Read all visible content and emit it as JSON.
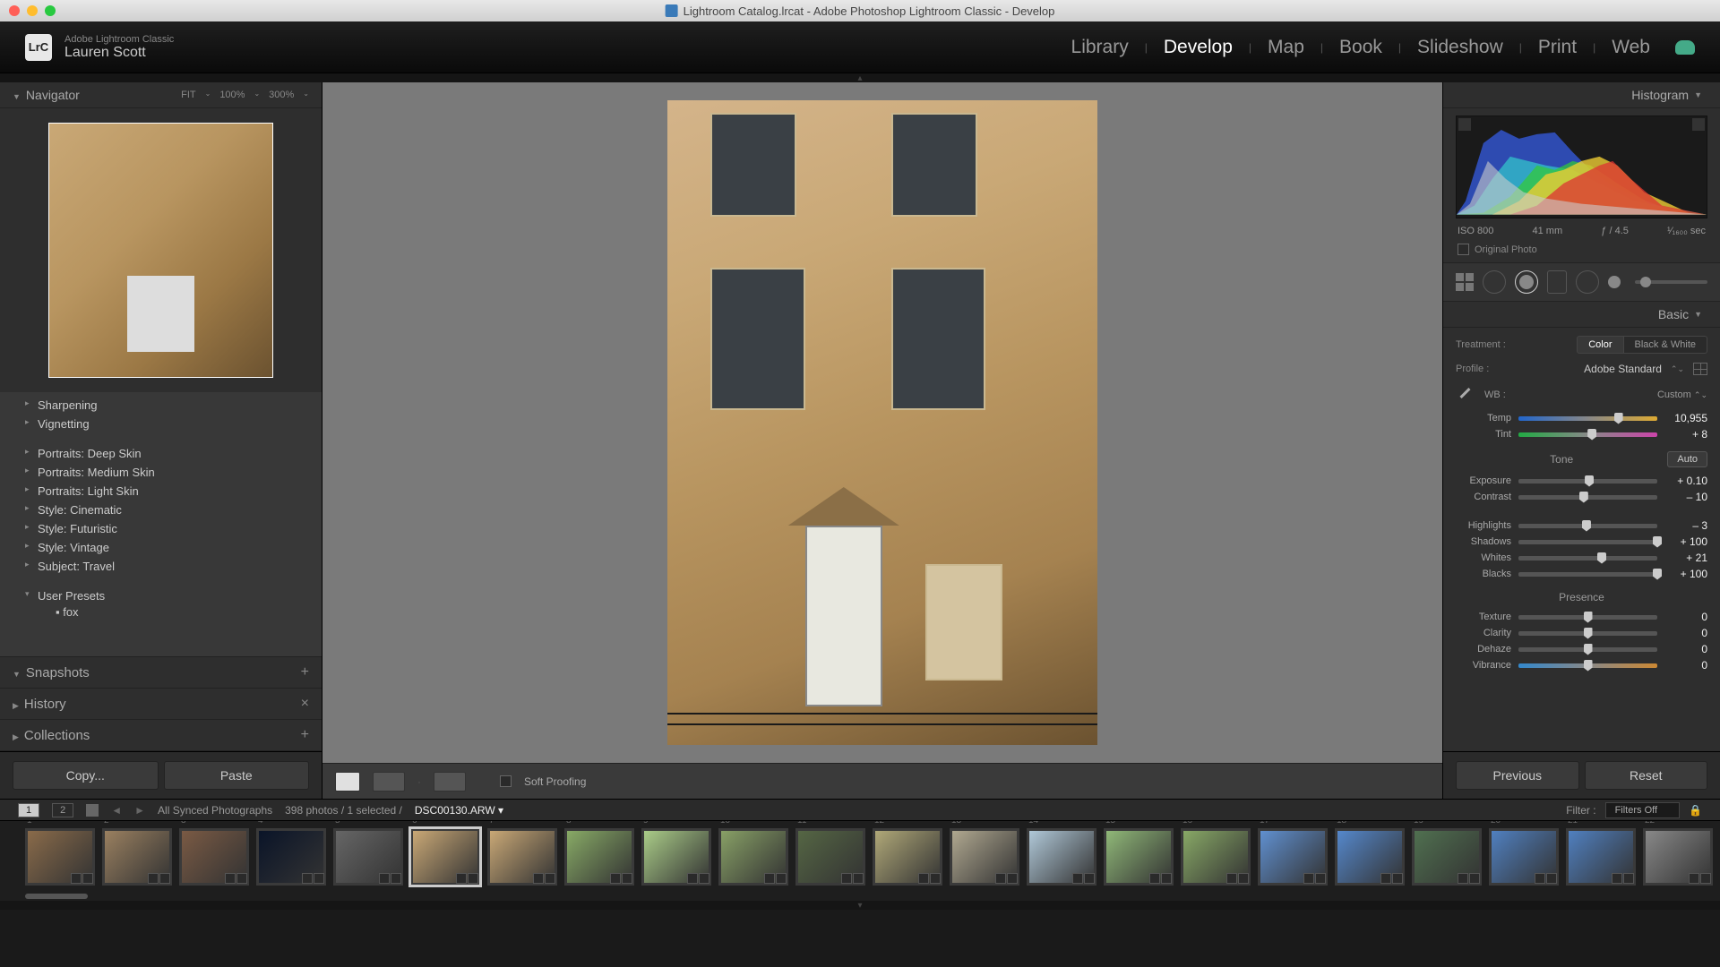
{
  "window": {
    "title": "Lightroom Catalog.lrcat - Adobe Photoshop Lightroom Classic - Develop"
  },
  "header": {
    "app_badge": "LrC",
    "app_line1": "Adobe Lightroom Classic",
    "user_name": "Lauren Scott",
    "modules": [
      "Library",
      "Develop",
      "Map",
      "Book",
      "Slideshow",
      "Print",
      "Web"
    ],
    "active_module": "Develop"
  },
  "left_panel": {
    "navigator": {
      "title": "Navigator",
      "zoom": [
        "FIT",
        "100%",
        "300%"
      ]
    },
    "presets": [
      {
        "label": "Sharpening"
      },
      {
        "label": "Vignetting"
      },
      {
        "gap": true
      },
      {
        "label": "Portraits: Deep Skin"
      },
      {
        "label": "Portraits: Medium Skin"
      },
      {
        "label": "Portraits: Light Skin"
      },
      {
        "label": "Style: Cinematic"
      },
      {
        "label": "Style: Futuristic"
      },
      {
        "label": "Style: Vintage"
      },
      {
        "label": "Subject: Travel"
      },
      {
        "gap": true
      },
      {
        "label": "User Presets",
        "expanded": true,
        "children": [
          "fox"
        ]
      }
    ],
    "sections": {
      "snapshots": "Snapshots",
      "history": "History",
      "collections": "Collections"
    },
    "buttons": {
      "copy": "Copy...",
      "paste": "Paste"
    }
  },
  "canvas_toolbar": {
    "soft_proofing": "Soft Proofing"
  },
  "right_panel": {
    "histogram_title": "Histogram",
    "histogram_info": {
      "iso": "ISO 800",
      "focal": "41 mm",
      "aperture": "ƒ / 4.5",
      "shutter": "¹⁄₁₆₀₀ sec"
    },
    "original_photo": "Original Photo",
    "basic": {
      "title": "Basic",
      "treatment_label": "Treatment :",
      "treatment_color": "Color",
      "treatment_bw": "Black & White",
      "profile_label": "Profile :",
      "profile_value": "Adobe Standard",
      "wb_label": "WB :",
      "wb_value": "Custom",
      "tone_label": "Tone",
      "auto": "Auto",
      "presence_label": "Presence",
      "sliders": {
        "temp": {
          "label": "Temp",
          "value": "10,955",
          "pos": 72,
          "track": "temp"
        },
        "tint": {
          "label": "Tint",
          "value": "+ 8",
          "pos": 53,
          "track": "tint"
        },
        "exposure": {
          "label": "Exposure",
          "value": "+ 0.10",
          "pos": 51,
          "track": "plain"
        },
        "contrast": {
          "label": "Contrast",
          "value": "– 10",
          "pos": 47,
          "track": "plain"
        },
        "highlights": {
          "label": "Highlights",
          "value": "– 3",
          "pos": 49,
          "track": "plain"
        },
        "shadows": {
          "label": "Shadows",
          "value": "+ 100",
          "pos": 100,
          "track": "plain"
        },
        "whites": {
          "label": "Whites",
          "value": "+ 21",
          "pos": 60,
          "track": "plain"
        },
        "blacks": {
          "label": "Blacks",
          "value": "+ 100",
          "pos": 100,
          "track": "plain"
        },
        "texture": {
          "label": "Texture",
          "value": "0",
          "pos": 50,
          "track": "plain"
        },
        "clarity": {
          "label": "Clarity",
          "value": "0",
          "pos": 50,
          "track": "plain"
        },
        "dehaze": {
          "label": "Dehaze",
          "value": "0",
          "pos": 50,
          "track": "plain"
        },
        "vibrance": {
          "label": "Vibrance",
          "value": "0",
          "pos": 50,
          "track": "vib"
        }
      }
    },
    "buttons": {
      "previous": "Previous",
      "reset": "Reset"
    }
  },
  "filmstrip_bar": {
    "source": "All Synced Photographs",
    "count": "398 photos / 1 selected /",
    "filename": "DSC00130.ARW",
    "filter_label": "Filter :",
    "filter_value": "Filters Off"
  },
  "filmstrip": {
    "count": 22,
    "selected_index": 6,
    "colors": [
      "#8a6b4a",
      "#9a8060",
      "#7a5a44",
      "#0a1428",
      "#666",
      "#c9a876",
      "#c9a876",
      "#88aa66",
      "#aacc88",
      "#88a066",
      "#556644",
      "#b0a878",
      "#b0a890",
      "#b0c8d8",
      "#90b878",
      "#88a866",
      "#6090d0",
      "#5588cc",
      "#507050",
      "#5080c0",
      "#5080c0",
      "#888"
    ]
  }
}
